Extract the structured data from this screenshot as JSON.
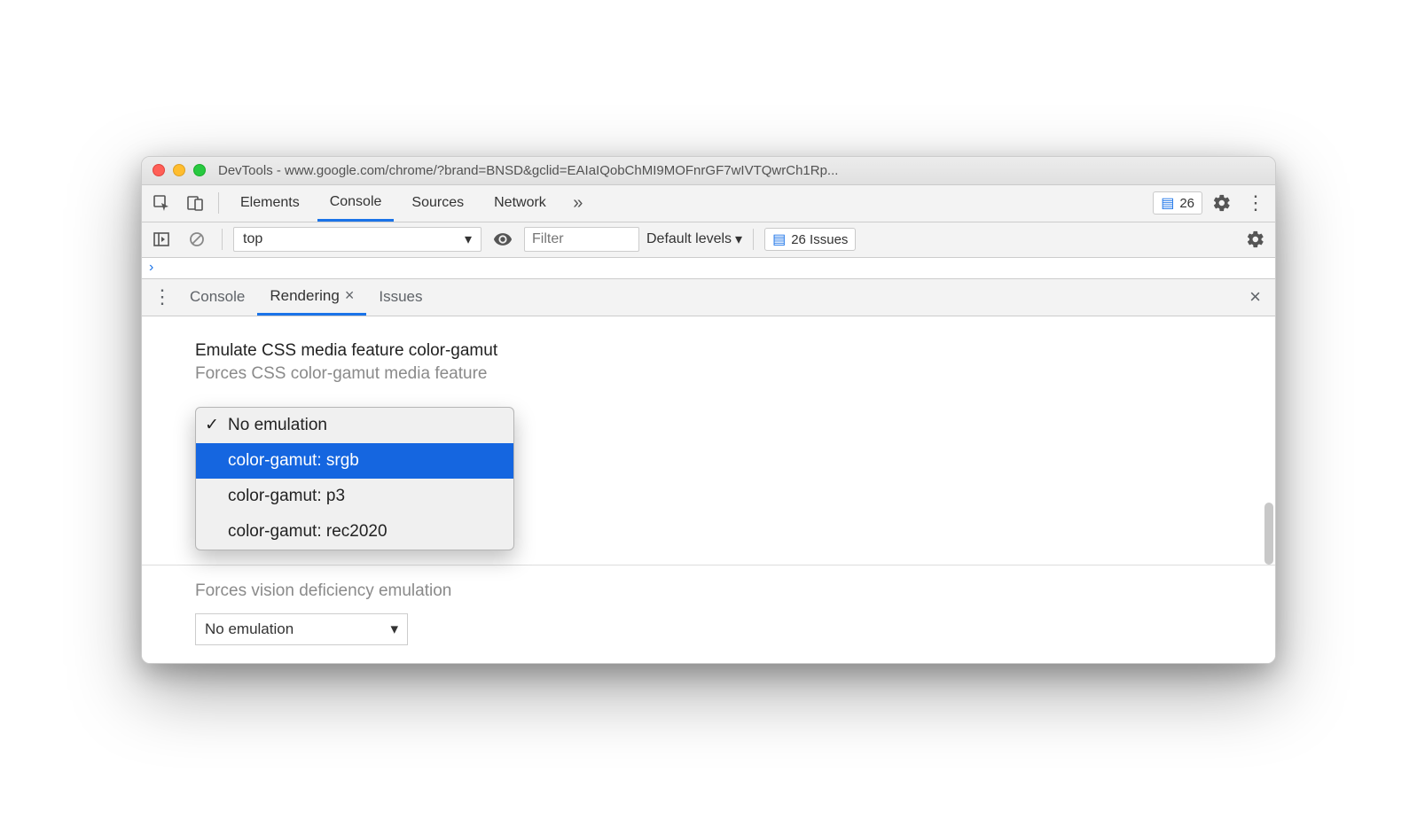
{
  "titlebar": {
    "title": "DevTools - www.google.com/chrome/?brand=BNSD&gclid=EAIaIQobChMI9MOFnrGF7wIVTQwrCh1Rp..."
  },
  "main_tabs": {
    "elements": "Elements",
    "console": "Console",
    "sources": "Sources",
    "network": "Network"
  },
  "issues_badge": {
    "count": "26"
  },
  "console_bar": {
    "context": "top",
    "filter_placeholder": "Filter",
    "levels": "Default levels",
    "issues_label": "26 Issues"
  },
  "drawer": {
    "tabs": {
      "console": "Console",
      "rendering": "Rendering",
      "issues": "Issues"
    }
  },
  "rendering": {
    "heading": "Emulate CSS media feature color-gamut",
    "desc": "Forces CSS color-gamut media feature",
    "options": {
      "none": "No emulation",
      "srgb": "color-gamut: srgb",
      "p3": "color-gamut: p3",
      "rec2020": "color-gamut: rec2020"
    },
    "below_partial": "Forces vision deficiency emulation",
    "select2": "No emulation"
  }
}
